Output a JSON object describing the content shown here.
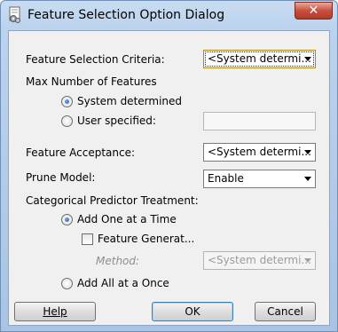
{
  "window": {
    "title": "Feature Selection Option Dialog",
    "close_glyph": "✕"
  },
  "fields": {
    "criteria": {
      "label": "Feature Selection Criteria:",
      "value": "<System determi..."
    },
    "max_features": {
      "label": "Max Number of Features",
      "options": [
        "System determined",
        "User specified:"
      ],
      "selected": "System determined",
      "user_value": ""
    },
    "acceptance": {
      "label": "Feature Acceptance:",
      "value": "<System determi..."
    },
    "prune": {
      "label": "Prune Model:",
      "value": "Enable"
    },
    "categorical": {
      "label": "Categorical Predictor Treatment:",
      "option_one": "Add One at a Time",
      "option_all": "Add All at a Once",
      "selected": "Add One at a Time",
      "feature_gen_label": "Feature Generat...",
      "feature_gen_checked": false,
      "method_label": "Method:",
      "method_value": "<System determi..."
    }
  },
  "buttons": {
    "help": "Help",
    "ok": "OK",
    "cancel": "Cancel"
  },
  "colors": {
    "titlebar": "#bcd3ee",
    "close": "#c7503e",
    "client": "#f0f0f0",
    "radio_dot": "#1b5fbf"
  },
  "icons": {
    "app": "gear-document-icon",
    "dropdown": "chevron-down-icon"
  }
}
